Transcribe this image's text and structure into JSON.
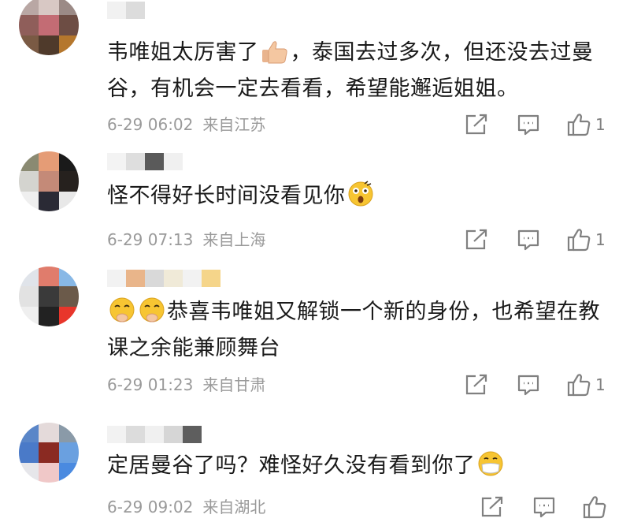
{
  "comments": [
    {
      "text_before": "韦唯姐太厉害了",
      "emoji": "thumbs-up",
      "text_after": "，泰国去过多次，但还没去过曼谷，有机会一定去看看，希望能邂逅姐姐。",
      "date": "6-29 06:02",
      "location": "来自江苏",
      "like_count": "1"
    },
    {
      "text_before": "怪不得好长时间没看见你",
      "emoji": "shocked-face",
      "text_after": "",
      "date": "6-29 07:13",
      "location": "来自上海",
      "like_count": "1"
    },
    {
      "text_before": "",
      "emoji": "shushing-face",
      "text_after": "恭喜韦唯姐又解锁一个新的身份，也希望在教课之余能兼顾舞台",
      "date": "6-29 01:23",
      "location": "来自甘肃",
      "like_count": "1"
    },
    {
      "text_before": "定居曼谷了吗？难怪好久没有看到你了",
      "emoji": "mask-face",
      "text_after": "",
      "date": "6-29 09:02",
      "location": "来自湖北",
      "like_count": ""
    }
  ],
  "colors": {
    "meta_text": "#9a9a9a",
    "icon": "#808080",
    "emoji_yellow": "#f7c532"
  },
  "icons": {
    "share": "share-icon",
    "comment": "comment-icon",
    "like": "like-icon"
  }
}
